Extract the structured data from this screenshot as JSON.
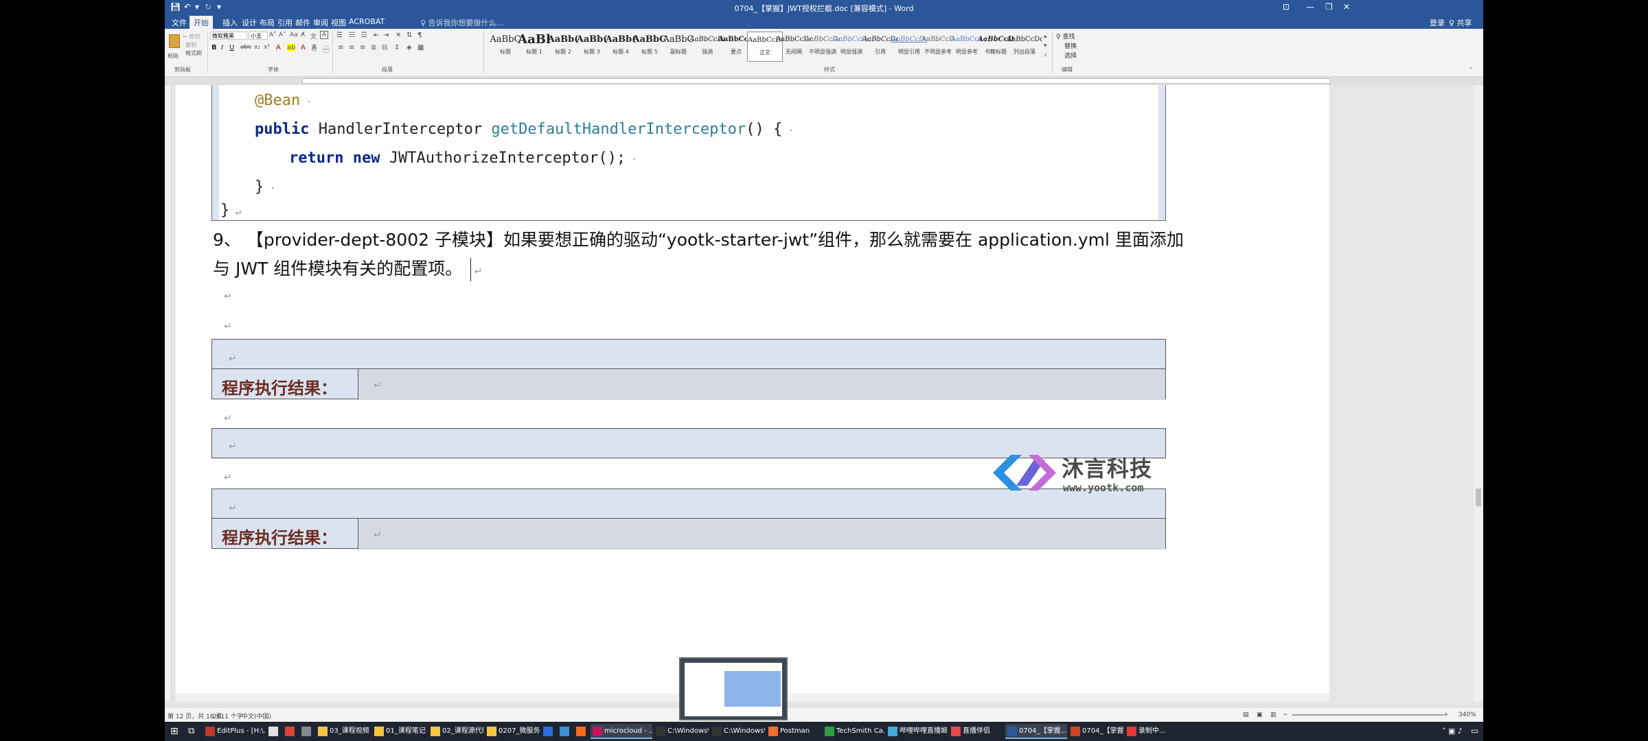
{
  "window": {
    "title": "0704_【掌握】JWT授权拦截.doc [兼容模式] - Word",
    "controls": [
      "⊡",
      "—",
      "❐",
      "✕"
    ]
  },
  "tabs": {
    "items": [
      "文件",
      "开始",
      "插入",
      "设计",
      "布局",
      "引用",
      "邮件",
      "审阅",
      "视图",
      "ACROBAT"
    ],
    "active": "开始",
    "search_placeholder": "♀ 告诉我你想要做什么...",
    "login": "登录",
    "share": "♀ 共享"
  },
  "ribbon": {
    "paste": "粘贴",
    "clipboard_label": "剪贴板",
    "cut": "✂ 剪切",
    "copy": "复制",
    "format_painter": "格式刷",
    "font_name": "微软雅黑",
    "font_size": "小五",
    "font_label": "字体",
    "paragraph_label": "段落",
    "styles_label": "样式",
    "edit_label": "编辑",
    "find": "♀ 查找",
    "replace": "替换",
    "select": "选择",
    "styles": [
      {
        "preview": "AaBbC",
        "label": "标题"
      },
      {
        "preview": "AaBl",
        "label": "标题 1"
      },
      {
        "preview": "AaBb(",
        "label": "标题 2"
      },
      {
        "preview": "AaBb(",
        "label": "标题 3"
      },
      {
        "preview": "AaBb(",
        "label": "标题 4"
      },
      {
        "preview": "AaBbC",
        "label": "标题 5"
      },
      {
        "preview": "AaBbC",
        "label": "副标题"
      },
      {
        "preview": "AaBbCcDı",
        "label": "强调"
      },
      {
        "preview": "AaBbCcD",
        "label": "要点"
      },
      {
        "preview": "AaBbCcDc",
        "label": "正文"
      },
      {
        "preview": "AaBbCcDc",
        "label": "无间隔"
      },
      {
        "preview": "AaBbCcDc",
        "label": "不明显强调"
      },
      {
        "preview": "AaBbCcDc",
        "label": "明显强调"
      },
      {
        "preview": "AaBbCcDc",
        "label": "引用"
      },
      {
        "preview": "AaBbCcDc",
        "label": "明显引用"
      },
      {
        "preview": "AaBbCcD",
        "label": "不明显参考"
      },
      {
        "preview": "AaBbCc1",
        "label": "明显参考"
      },
      {
        "preview": "AaBbCcD",
        "label": "书籍标题"
      },
      {
        "preview": "AaBbCcDc",
        "label": "列出段落"
      }
    ]
  },
  "document": {
    "code": {
      "line1": "@Bean",
      "line2_kw": "public",
      "line2_type": " HandlerInterceptor ",
      "line2_fn": "getDefaultHandlerInterceptor",
      "line2_rest": "() {",
      "line3_kw1": "return",
      "line3_kw2": "new",
      "line3_rest": " JWTAuthorizeInterceptor();",
      "line4": "}",
      "line5": "}"
    },
    "paragraph": {
      "line1": "9、  【provider-dept-8002 子模块】如果要想正确的驱动“yootk-starter-jwt”组件，那么就需要在 application.yml 里面添加",
      "line2": "与 JWT 组件模块有关的配置项。"
    },
    "result_label_1": "程序执行结果：",
    "result_label_2": "程序执行结果："
  },
  "logo": {
    "name": "沐言科技",
    "url": "www.yootk.com"
  },
  "statusbar": {
    "page": "第 12 页，共 18 页",
    "words": "2611 个字",
    "lang": "中文(中国)",
    "zoom": "340%"
  },
  "taskbar": {
    "items": [
      {
        "label": "EditPlus - [H:\\...",
        "color": "#c0392b"
      },
      {
        "label": "",
        "color": "#e0e0e0"
      },
      {
        "label": "",
        "color": "#db4437"
      },
      {
        "label": "",
        "color": "#7f8c8d"
      },
      {
        "label": "03_课程视频",
        "color": "#f4c542"
      },
      {
        "label": "01_课程笔记",
        "color": "#f4c542"
      },
      {
        "label": "02_课程源代码",
        "color": "#f4c542"
      },
      {
        "label": "0207_微服务...",
        "color": "#f4c542"
      },
      {
        "label": "",
        "color": "#2d6cdf"
      },
      {
        "label": "",
        "color": "#3b8fd6"
      },
      {
        "label": "",
        "color": "#f26b21"
      },
      {
        "label": "microcloud - ...",
        "color": "#c2185b"
      },
      {
        "label": "C:\\Windows\\s...",
        "color": "#333"
      },
      {
        "label": "C:\\Windows\\s...",
        "color": "#333"
      },
      {
        "label": "Postman",
        "color": "#ef6c35"
      },
      {
        "label": "TechSmith Ca...",
        "color": "#2e9d44"
      },
      {
        "label": "哔哩哔哩直播姬",
        "color": "#4aa8d8"
      },
      {
        "label": "直播伴侣",
        "color": "#e24a4a"
      },
      {
        "label": "0704_【掌握...",
        "color": "#2b579a"
      },
      {
        "label": "0704_【掌握...",
        "color": "#d04423"
      },
      {
        "label": "录制中...",
        "color": "#e53935"
      }
    ]
  }
}
